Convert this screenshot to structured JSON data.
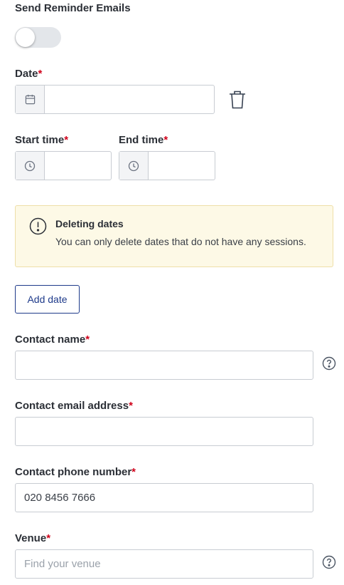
{
  "reminder": {
    "label": "Send Reminder Emails",
    "enabled": false
  },
  "date": {
    "label": "Date",
    "required_mark": "*",
    "value": ""
  },
  "start_time": {
    "label": "Start time",
    "required_mark": "*",
    "value": ""
  },
  "end_time": {
    "label": "End time",
    "required_mark": "*",
    "value": ""
  },
  "notice": {
    "title": "Deleting dates",
    "body": "You can only delete dates that do not have any sessions."
  },
  "add_date_button": "Add date",
  "contact_name": {
    "label": "Contact name",
    "required_mark": "*",
    "value": ""
  },
  "contact_email": {
    "label": "Contact email address",
    "required_mark": "*",
    "value": ""
  },
  "contact_phone": {
    "label": "Contact phone number",
    "required_mark": "*",
    "value": "020 8456 7666"
  },
  "venue": {
    "label": "Venue",
    "required_mark": "*",
    "placeholder": "Find your venue"
  },
  "icons": {
    "calendar": "calendar-icon",
    "clock": "clock-icon",
    "trash": "trash-icon",
    "info": "exclamation-circle-icon",
    "help": "question-circle-icon"
  },
  "colors": {
    "required": "#d0021b",
    "button_border": "#1e3a8a",
    "notice_bg": "#fdf9e6",
    "notice_border": "#eedfa8"
  }
}
